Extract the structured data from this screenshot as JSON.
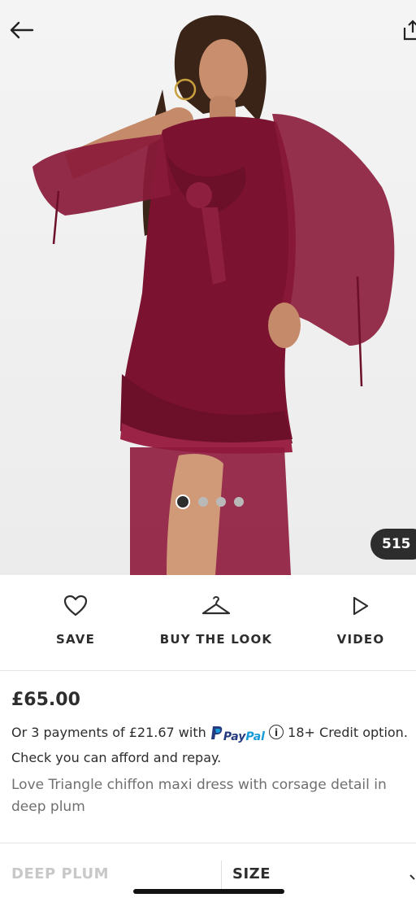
{
  "gallery": {
    "image_count": "515",
    "total_images": 4,
    "active_index": 0,
    "image_description_icon": "photo-icon"
  },
  "header": {
    "back_icon": "arrow-left-icon",
    "share_icon": "share-icon"
  },
  "actions": [
    {
      "label": "SAVE",
      "icon": "heart-icon"
    },
    {
      "label": "BUY THE LOOK",
      "icon": "hanger-icon"
    },
    {
      "label": "VIDEO",
      "icon": "play-icon"
    }
  ],
  "product": {
    "price": "£65.00",
    "installments_prefix": "Or 3 payments of £21.67 with",
    "paypal_pay": "Pay",
    "paypal_pal": "Pal",
    "installments_suffix": "18+ Credit option. Check you can afford and repay.",
    "description": "Love Triangle chiffon maxi dress with corsage detail in deep plum"
  },
  "selectors": {
    "colour": "DEEP PLUM",
    "size": "SIZE"
  },
  "colors": {
    "dress": "#7a1230",
    "text": "#2d2d2d",
    "muted": "#6f6f6f",
    "paypal_dark": "#253b80",
    "paypal_light": "#179bd7"
  }
}
